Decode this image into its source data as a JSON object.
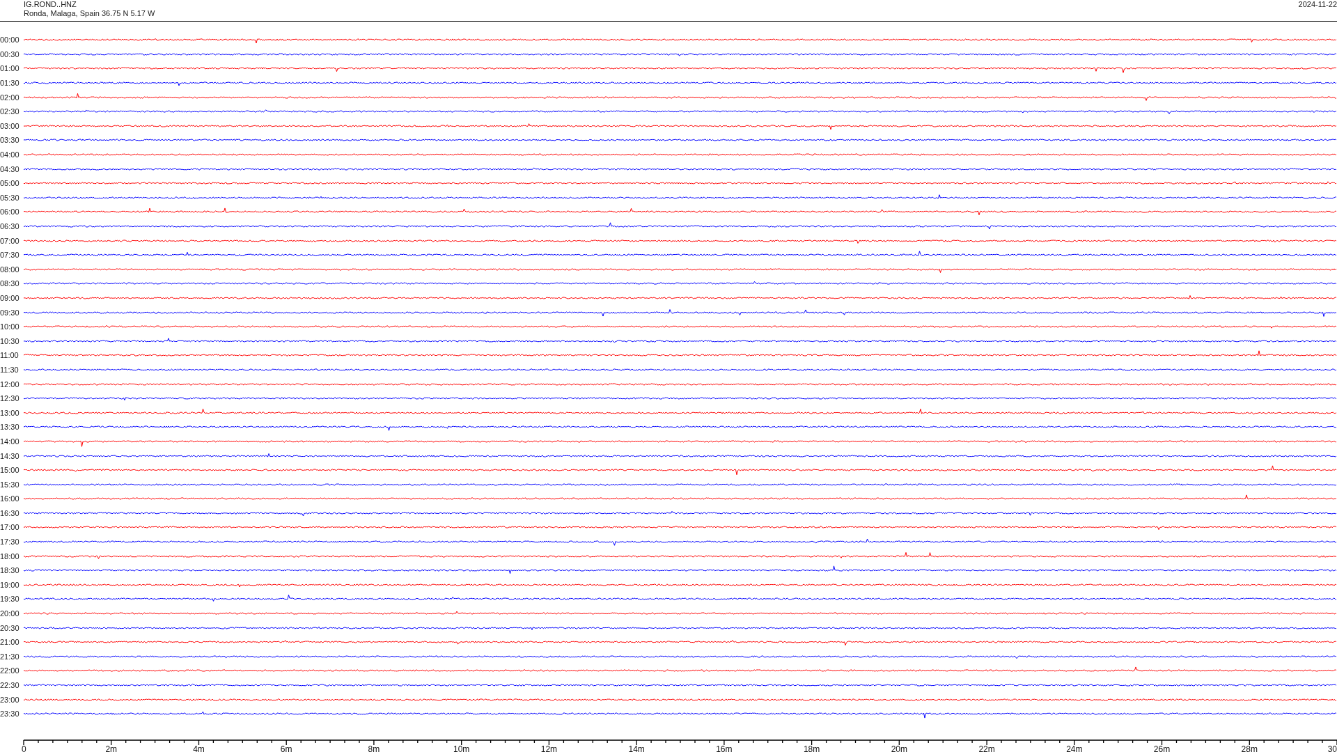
{
  "header": {
    "station": "IG.ROND..HNZ",
    "location": "Ronda, Malaga, Spain  36.75 N 5.17 W",
    "date": "2024-11-22"
  },
  "traces": [
    {
      "label": "00:00",
      "color": "#ff0000"
    },
    {
      "label": "00:30",
      "color": "#0000ff"
    },
    {
      "label": "01:00",
      "color": "#ff0000"
    },
    {
      "label": "01:30",
      "color": "#0000ff"
    },
    {
      "label": "02:00",
      "color": "#ff0000"
    },
    {
      "label": "02:30",
      "color": "#0000ff"
    },
    {
      "label": "03:00",
      "color": "#ff0000"
    },
    {
      "label": "03:30",
      "color": "#0000ff"
    },
    {
      "label": "04:00",
      "color": "#ff0000"
    },
    {
      "label": "04:30",
      "color": "#0000ff"
    },
    {
      "label": "05:00",
      "color": "#ff0000"
    },
    {
      "label": "05:30",
      "color": "#0000ff"
    },
    {
      "label": "06:00",
      "color": "#ff0000"
    },
    {
      "label": "06:30",
      "color": "#0000ff"
    },
    {
      "label": "07:00",
      "color": "#ff0000"
    },
    {
      "label": "07:30",
      "color": "#0000ff"
    },
    {
      "label": "08:00",
      "color": "#ff0000"
    },
    {
      "label": "08:30",
      "color": "#0000ff"
    },
    {
      "label": "09:00",
      "color": "#ff0000"
    },
    {
      "label": "09:30",
      "color": "#0000ff"
    },
    {
      "label": "10:00",
      "color": "#ff0000"
    },
    {
      "label": "10:30",
      "color": "#0000ff"
    },
    {
      "label": "11:00",
      "color": "#ff0000"
    },
    {
      "label": "11:30",
      "color": "#0000ff"
    },
    {
      "label": "12:00",
      "color": "#ff0000"
    },
    {
      "label": "12:30",
      "color": "#0000ff"
    },
    {
      "label": "13:00",
      "color": "#ff0000"
    },
    {
      "label": "13:30",
      "color": "#0000ff"
    },
    {
      "label": "14:00",
      "color": "#ff0000"
    },
    {
      "label": "14:30",
      "color": "#0000ff"
    },
    {
      "label": "15:00",
      "color": "#ff0000"
    },
    {
      "label": "15:30",
      "color": "#0000ff"
    },
    {
      "label": "16:00",
      "color": "#ff0000"
    },
    {
      "label": "16:30",
      "color": "#0000ff"
    },
    {
      "label": "17:00",
      "color": "#ff0000"
    },
    {
      "label": "17:30",
      "color": "#0000ff"
    },
    {
      "label": "18:00",
      "color": "#ff0000"
    },
    {
      "label": "18:30",
      "color": "#0000ff"
    },
    {
      "label": "19:00",
      "color": "#ff0000"
    },
    {
      "label": "19:30",
      "color": "#0000ff"
    },
    {
      "label": "20:00",
      "color": "#ff0000"
    },
    {
      "label": "20:30",
      "color": "#0000ff"
    },
    {
      "label": "21:00",
      "color": "#ff0000"
    },
    {
      "label": "21:30",
      "color": "#0000ff"
    },
    {
      "label": "22:00",
      "color": "#ff0000"
    },
    {
      "label": "22:30",
      "color": "#0000ff"
    },
    {
      "label": "23:00",
      "color": "#ff0000"
    },
    {
      "label": "23:30",
      "color": "#0000ff"
    }
  ],
  "x_axis": {
    "labels": [
      "0",
      "2m",
      "4m",
      "6m",
      "8m",
      "10m",
      "12m",
      "14m",
      "16m",
      "18m",
      "20m",
      "22m",
      "24m",
      "26m",
      "28m",
      "30"
    ]
  }
}
